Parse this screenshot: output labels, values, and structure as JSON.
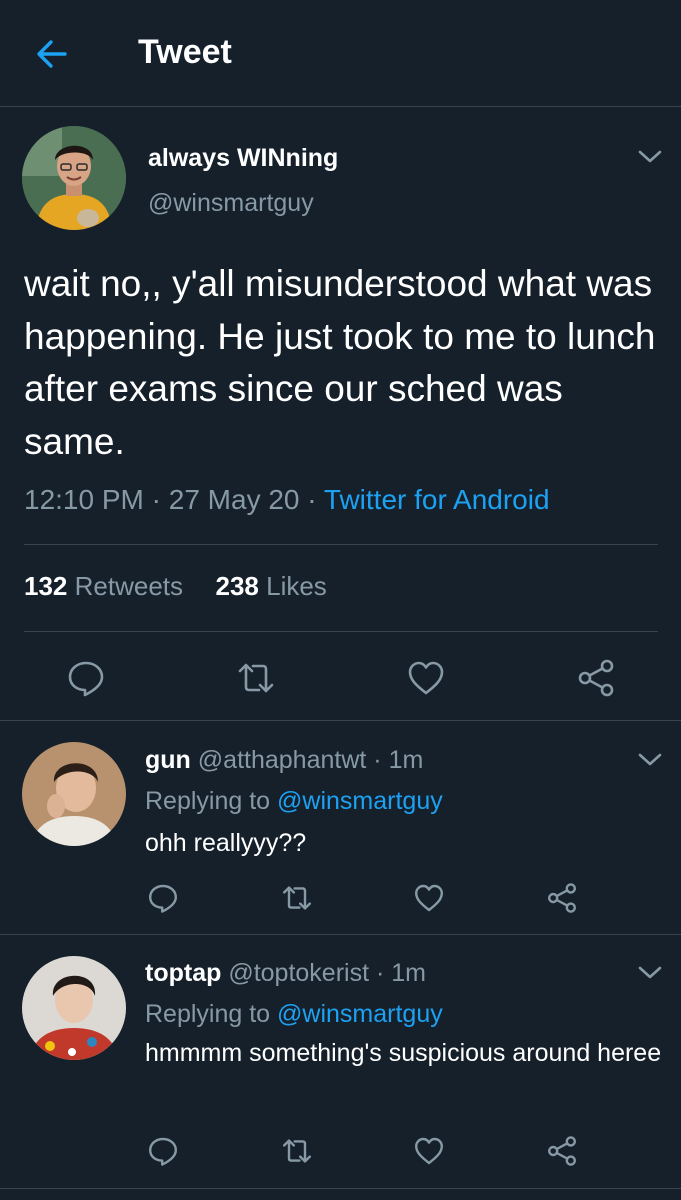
{
  "header": {
    "title": "Tweet"
  },
  "tweet": {
    "author_name": "always WINning",
    "author_handle": "@winsmartguy",
    "text": "wait no,, y'all misunderstood what was happening. He just took to me to lunch after exams since our sched was same.",
    "time": "12:10 PM",
    "date": "27 May 20",
    "source": "Twitter for Android",
    "separator": "·",
    "retweet_count": "132",
    "retweet_label": "Retweets",
    "like_count": "238",
    "like_label": "Likes"
  },
  "replies": [
    {
      "name": "gun",
      "handle": "@atthaphantwt",
      "time": "1m",
      "replying_label": "Replying to",
      "replying_to": "@winsmartguy",
      "text": "ohh reallyyy??"
    },
    {
      "name": "toptap",
      "handle": "@toptokerist",
      "time": "1m",
      "replying_label": "Replying to",
      "replying_to": "@winsmartguy",
      "text": "hmmmm something's suspicious around heree"
    }
  ],
  "colors": {
    "background": "#15202b",
    "accent": "#1da1f2",
    "secondary_text": "#8899a6",
    "divider": "#38444d"
  },
  "icons": [
    "back-arrow-icon",
    "chevron-down-icon",
    "reply-icon",
    "retweet-icon",
    "like-icon",
    "share-icon"
  ]
}
